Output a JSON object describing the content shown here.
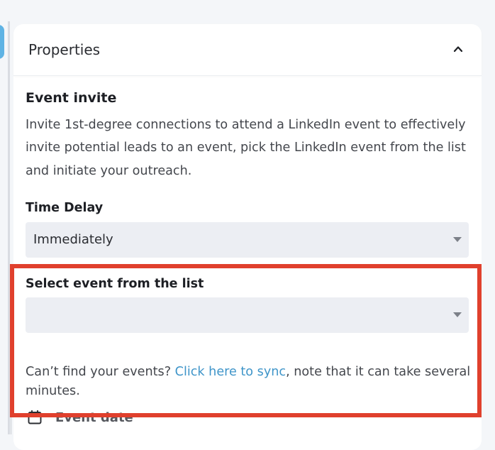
{
  "panel": {
    "title": "Properties",
    "collapse_icon": "chevron-up-icon"
  },
  "event_invite": {
    "title": "Event invite",
    "description": "Invite 1st-degree connections to attend a LinkedIn event to effectively invite potential leads to an event, pick the LinkedIn event from the list and initiate your outreach."
  },
  "time_delay": {
    "label": "Time Delay",
    "selected": "Immediately"
  },
  "event_select": {
    "label": "Select event from the list",
    "selected": "",
    "help_before": "Can’t find your events? ",
    "help_link": "Click here to sync",
    "help_after": ", note that it can take several minutes."
  },
  "event_date": {
    "icon": "calendar-icon",
    "label": "Event date"
  },
  "colors": {
    "highlight": "#e0402d",
    "link": "#3f95c9",
    "field_bg": "#eceef3",
    "tab_accent": "#5fb3e4"
  }
}
